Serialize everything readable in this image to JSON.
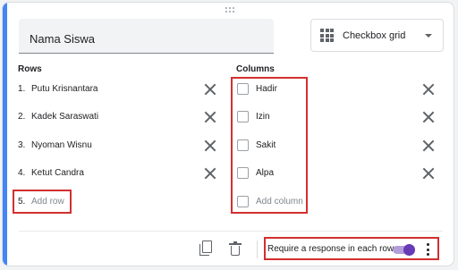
{
  "question": {
    "title": "Nama Siswa",
    "type_label": "Checkbox grid",
    "type_icon": "grid-icon"
  },
  "rows": {
    "label": "Rows",
    "items": [
      {
        "num": "1.",
        "text": "Putu Krisnantara"
      },
      {
        "num": "2.",
        "text": "Kadek Saraswati"
      },
      {
        "num": "3.",
        "text": "Nyoman Wisnu"
      },
      {
        "num": "4.",
        "text": "Ketut Candra"
      }
    ],
    "add": {
      "num": "5.",
      "text": "Add row"
    }
  },
  "columns": {
    "label": "Columns",
    "items": [
      {
        "text": "Hadir"
      },
      {
        "text": "Izin"
      },
      {
        "text": "Sakit"
      },
      {
        "text": "Alpa"
      }
    ],
    "add": {
      "text": "Add column"
    }
  },
  "footer": {
    "require_label": "Require a response in each row",
    "require_enabled": true
  },
  "colors": {
    "accent": "#4285f4",
    "toggle": "#673ab7",
    "highlight": "#d32f2f"
  }
}
